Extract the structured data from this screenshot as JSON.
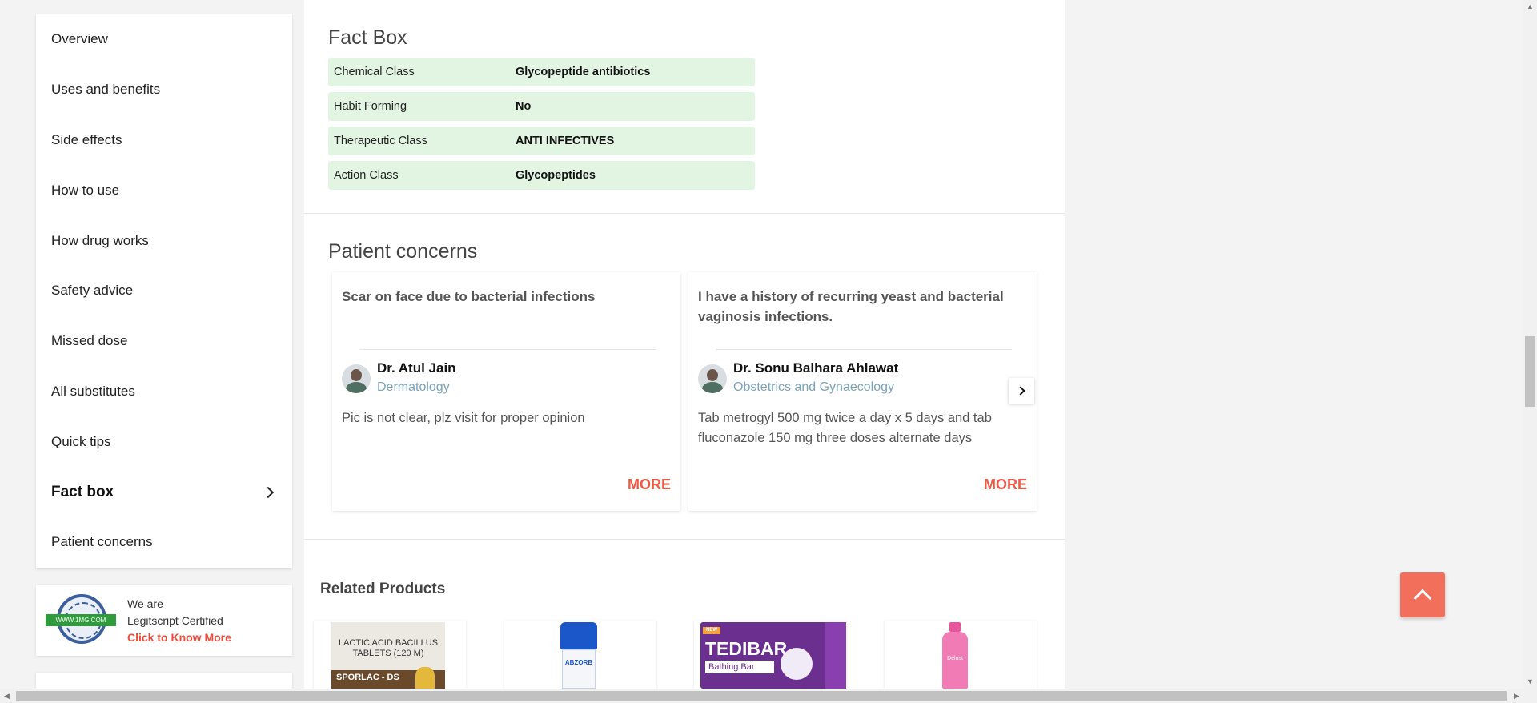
{
  "sidebar": {
    "items": [
      {
        "label": "Overview"
      },
      {
        "label": "Uses and benefits"
      },
      {
        "label": "Side effects"
      },
      {
        "label": "How to use"
      },
      {
        "label": "How drug works"
      },
      {
        "label": "Safety advice"
      },
      {
        "label": "Missed dose"
      },
      {
        "label": "All substitutes"
      },
      {
        "label": "Quick tips"
      },
      {
        "label": "Fact box",
        "active": true
      },
      {
        "label": "Patient concerns"
      }
    ],
    "active_icon": "chevron-right-icon"
  },
  "legitscript": {
    "line1": "We are",
    "line2": "Legitscript Certified",
    "link": "Click to Know More",
    "seal_text": "WWW.1MG.COM"
  },
  "fact_box": {
    "title": "Fact Box",
    "rows": [
      {
        "key": "Chemical Class",
        "value": "Glycopeptide antibiotics"
      },
      {
        "key": "Habit Forming",
        "value": "No"
      },
      {
        "key": "Therapeutic Class",
        "value": "ANTI INFECTIVES"
      },
      {
        "key": "Action Class",
        "value": "Glycopeptides"
      }
    ],
    "row_color": "#e2f5e3"
  },
  "patient_concerns": {
    "title": "Patient concerns",
    "cards": [
      {
        "question": "Scar on face due to bacterial infections",
        "doctor": "Dr. Atul Jain",
        "specialty": "Dermatology",
        "answer": "Pic is not clear, plz visit for proper opinion",
        "more": "MORE"
      },
      {
        "question": "I have a history of recurring yeast and bacterial vaginosis infections.",
        "doctor": "Dr. Sonu Balhara Ahlawat",
        "specialty": "Obstetrics and Gynaecology",
        "answer": "Tab metrogyl 500 mg twice a day x 5 days and tab fluconazole 150 mg three doses alternate days",
        "more": "MORE"
      }
    ],
    "next_icon": "chevron-right-icon"
  },
  "related_products": {
    "title": "Related Products",
    "products": [
      {
        "label": "LACTIC ACID BACILLUS TABLETS (120 M)",
        "brand": "SPORLAC - DS"
      },
      {
        "label": "ABZORB"
      },
      {
        "label": "TEDIBAR",
        "sub": "Bathing Bar",
        "badge": "NEW"
      },
      {
        "label": "Delust"
      }
    ]
  },
  "colors": {
    "accent": "#ef5a47",
    "back_to_top": "#f26f5c",
    "specialty": "#7ba3b8"
  },
  "back_to_top_icon": "chevron-up-icon"
}
